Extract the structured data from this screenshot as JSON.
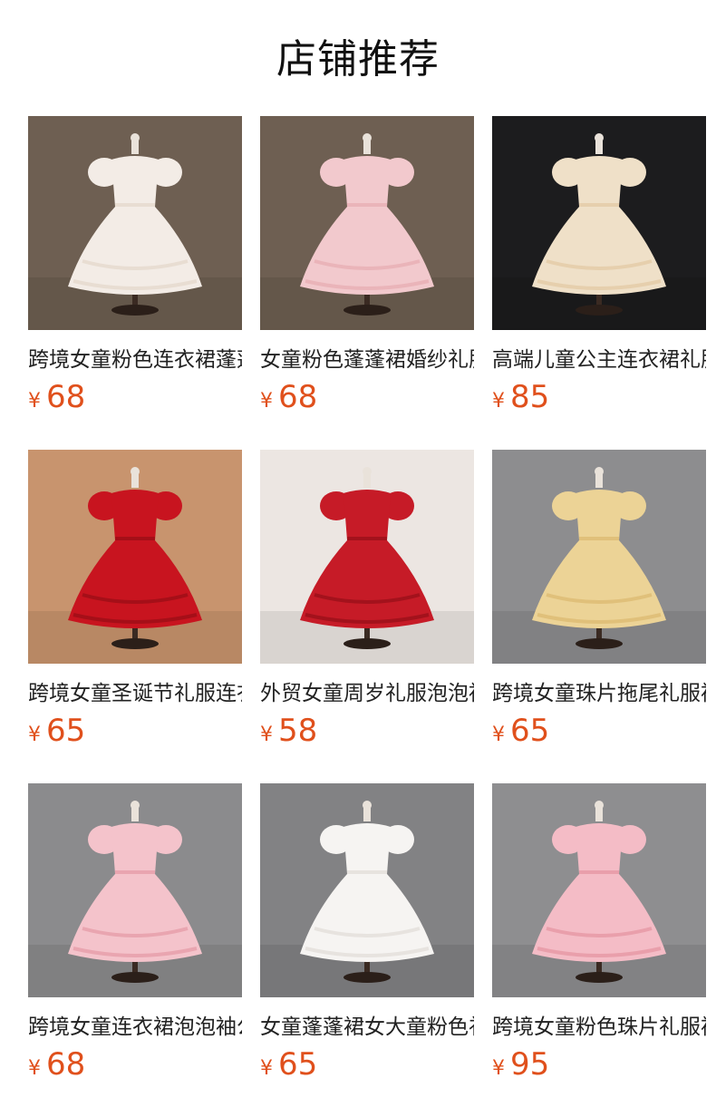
{
  "header": {
    "title": "店铺推荐"
  },
  "currency_symbol": "¥",
  "products": [
    {
      "name": "跨境女童粉色连衣裙蓬蓬裙",
      "price": "68",
      "image": "white-sequin-dress-icon",
      "bg": "#6e5f52",
      "dress": "#f3ece6",
      "accent": "#e8ddd2"
    },
    {
      "name": "女童粉色蓬蓬裙婚纱礼服",
      "price": "68",
      "image": "pink-sequin-dress-icon",
      "bg": "#6e5f52",
      "dress": "#f2c9cd",
      "accent": "#eab4b9"
    },
    {
      "name": "高端儿童公主连衣裙礼服",
      "price": "85",
      "image": "champagne-dress-icon",
      "bg": "#1c1c1e",
      "dress": "#efe0c8",
      "accent": "#e6cfad"
    },
    {
      "name": "跨境女童圣诞节礼服连衣裙",
      "price": "65",
      "image": "red-christmas-dress-icon",
      "bg": "#c8946e",
      "dress": "#c8141f",
      "accent": "#a50f18"
    },
    {
      "name": "外贸女童周岁礼服泡泡袖",
      "price": "58",
      "image": "red-satin-dress-icon",
      "bg": "#ece6e2",
      "dress": "#c61b27",
      "accent": "#a3121c"
    },
    {
      "name": "跨境女童珠片拖尾礼服裙",
      "price": "65",
      "image": "gold-tail-dress-icon",
      "bg": "#8d8d8f",
      "dress": "#ecd396",
      "accent": "#e0c07a"
    },
    {
      "name": "跨境女童连衣裙泡泡袖公主裙",
      "price": "68",
      "image": "pink-ruffle-gown-icon",
      "bg": "#8b8b8d",
      "dress": "#f4c3cb",
      "accent": "#e9a5b0"
    },
    {
      "name": "女童蓬蓬裙女大童粉色礼服",
      "price": "65",
      "image": "white-tulle-dress-icon",
      "bg": "#828284",
      "dress": "#f6f4f2",
      "accent": "#e7e3df"
    },
    {
      "name": "跨境女童粉色珠片礼服裙",
      "price": "95",
      "image": "pink-bow-dress-icon",
      "bg": "#8e8e90",
      "dress": "#f4bcc6",
      "accent": "#e99fab"
    }
  ]
}
